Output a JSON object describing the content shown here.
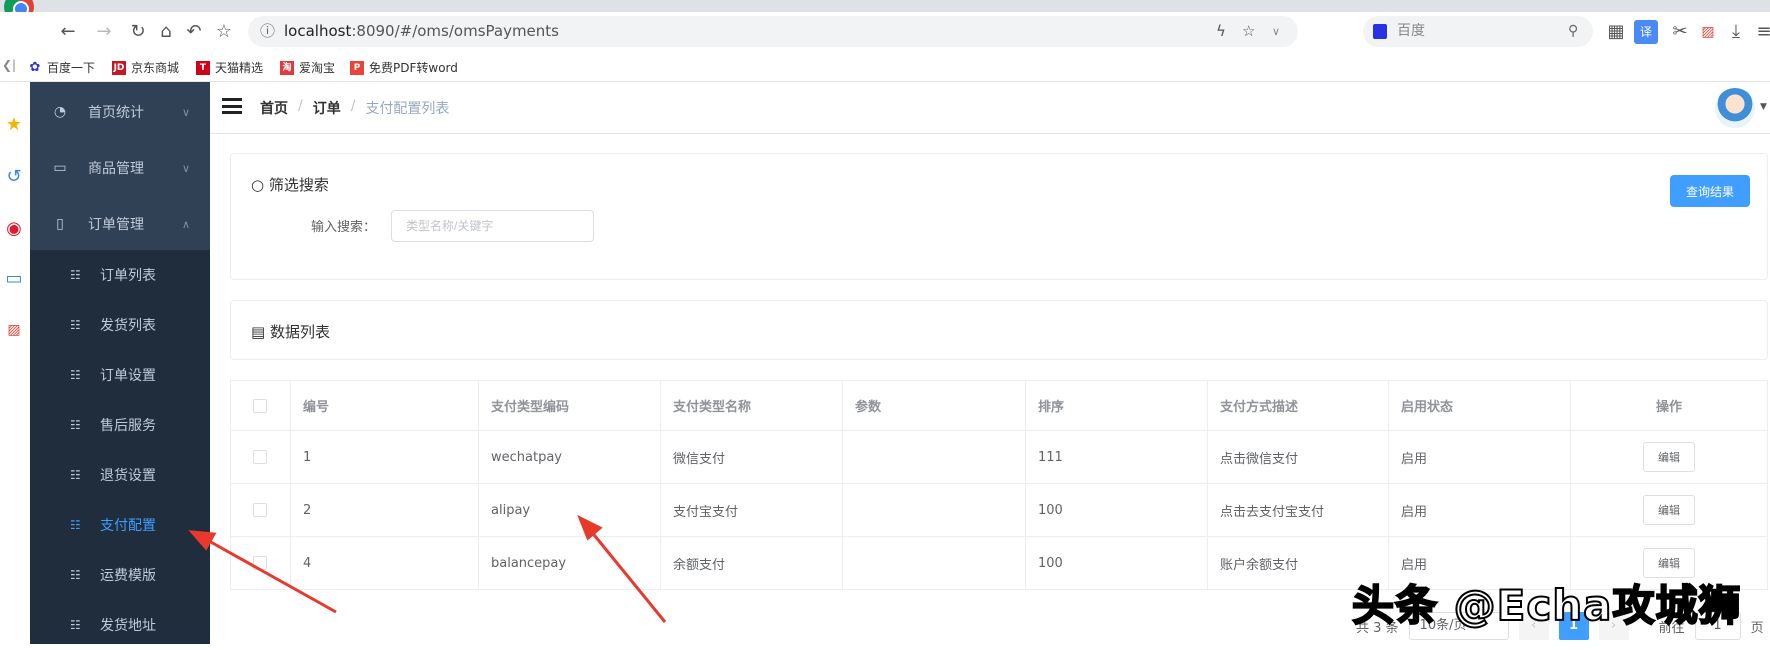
{
  "browser": {
    "url_host": "localhost",
    "url_rest": ":8090/#/oms/omsPayments",
    "search_placeholder": "百度",
    "bookmarks": [
      {
        "label": "百度一下",
        "icon": "baidu-icon",
        "color": "#2932e1"
      },
      {
        "label": "京东商城",
        "icon": "jd-icon",
        "color": "#c91623",
        "glyph": "JD"
      },
      {
        "label": "天猫精选",
        "icon": "tmall-icon",
        "color": "#d0021b",
        "glyph": "T"
      },
      {
        "label": "爱淘宝",
        "icon": "aitaobao-icon",
        "color": "#e4393c",
        "glyph": "淘"
      },
      {
        "label": "免费PDF转word",
        "icon": "pdf-icon",
        "color": "#e9443a",
        "glyph": "P"
      }
    ]
  },
  "sidebar": {
    "menus": [
      {
        "label": "首页统计",
        "icon": "dashboard-icon",
        "expanded": false
      },
      {
        "label": "商品管理",
        "icon": "monitor-chart-icon",
        "expanded": false
      },
      {
        "label": "订单管理",
        "icon": "clipboard-icon",
        "expanded": true
      }
    ],
    "submenu": [
      {
        "label": "订单列表"
      },
      {
        "label": "发货列表"
      },
      {
        "label": "订单设置"
      },
      {
        "label": "售后服务"
      },
      {
        "label": "退货设置"
      },
      {
        "label": "支付配置",
        "active": true
      },
      {
        "label": "运费模版"
      },
      {
        "label": "发货地址"
      }
    ]
  },
  "header": {
    "breadcrumb": [
      "首页",
      "订单",
      "支付配置列表"
    ]
  },
  "filter": {
    "title": "筛选搜索",
    "label": "输入搜索：",
    "placeholder": "类型名称/关键字",
    "value": "",
    "button": "查询结果"
  },
  "list": {
    "title": "数据列表",
    "columns": [
      "编号",
      "支付类型编码",
      "支付类型名称",
      "参数",
      "排序",
      "支付方式描述",
      "启用状态",
      "操作"
    ],
    "rows": [
      {
        "id": "1",
        "code": "wechatpay",
        "name": "微信支付",
        "params": "",
        "sort": "111",
        "desc": "点击微信支付",
        "status": "启用",
        "action": "编辑"
      },
      {
        "id": "2",
        "code": "alipay",
        "name": "支付宝支付",
        "params": "",
        "sort": "100",
        "desc": "点击去支付宝支付",
        "status": "启用",
        "action": "编辑"
      },
      {
        "id": "4",
        "code": "balancepay",
        "name": "余额支付",
        "params": "",
        "sort": "100",
        "desc": "账户余额支付",
        "status": "启用",
        "action": "编辑"
      }
    ]
  },
  "pagination": {
    "total": "共 3 条",
    "page_size": "10条/页",
    "current": "1",
    "goto_label": "前往",
    "goto_value": "1",
    "page_suffix": "页"
  },
  "watermark": "头条 @Echa攻城狮",
  "colors": {
    "sidebar": "#304156",
    "submenu": "#1f2d3d",
    "accent": "#409eff",
    "annotation": "#e8392c"
  }
}
